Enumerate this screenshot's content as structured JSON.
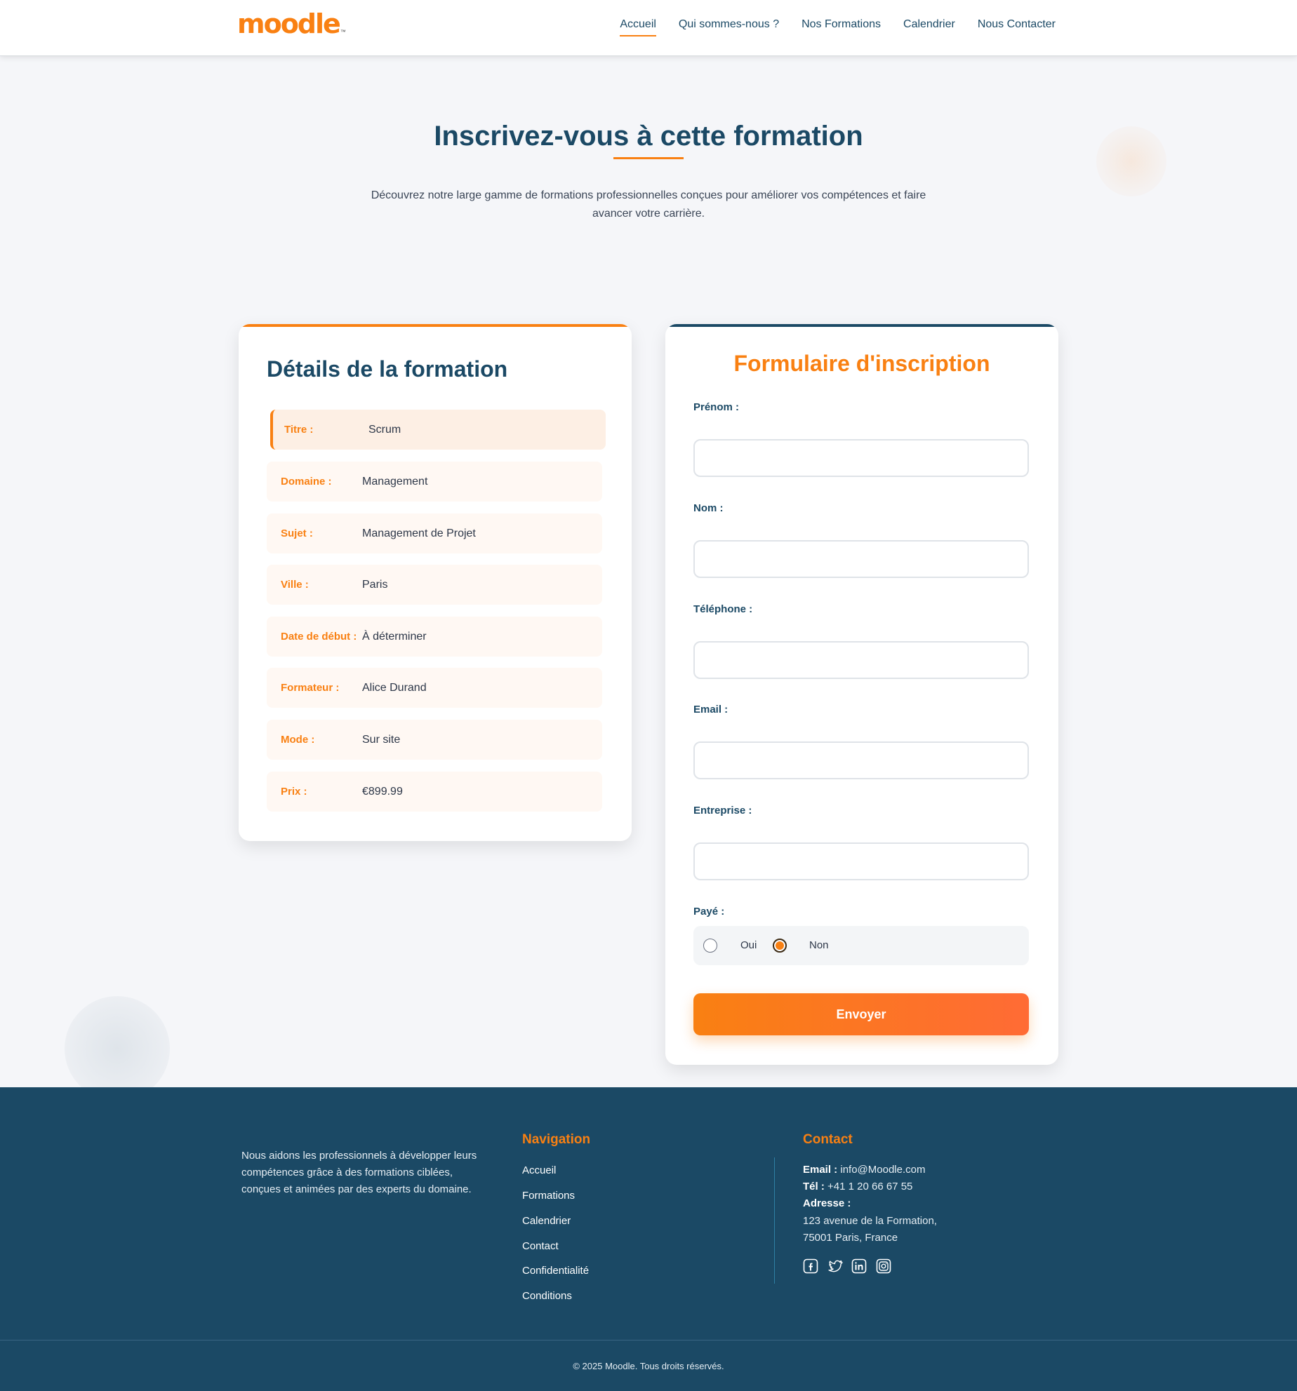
{
  "brand": {
    "name": "moodle",
    "tm": "™",
    "accent_color": "#f98012",
    "primary_color": "#1b4965"
  },
  "nav": {
    "items": [
      {
        "label": "Accueil",
        "active": true
      },
      {
        "label": "Qui sommes-nous ?",
        "active": false
      },
      {
        "label": "Nos Formations",
        "active": false
      },
      {
        "label": "Calendrier",
        "active": false
      },
      {
        "label": "Nous Contacter",
        "active": false
      }
    ]
  },
  "hero": {
    "title": "Inscrivez-vous à cette formation",
    "subtitle": "Découvrez notre large gamme de formations professionnelles conçues pour améliorer vos compétences et faire avancer votre carrière."
  },
  "details": {
    "title": "Détails de la formation",
    "rows": [
      {
        "label": "Titre :",
        "value": "Scrum"
      },
      {
        "label": "Domaine :",
        "value": "Management"
      },
      {
        "label": "Sujet :",
        "value": "Management de Projet"
      },
      {
        "label": "Ville :",
        "value": "Paris"
      },
      {
        "label": "Date de début :",
        "value": "À déterminer"
      },
      {
        "label": "Formateur :",
        "value": "Alice Durand"
      },
      {
        "label": "Mode :",
        "value": "Sur site"
      },
      {
        "label": "Prix :",
        "value": "€899.99"
      }
    ]
  },
  "form": {
    "title": "Formulaire d'inscription",
    "fields": [
      {
        "label": "Prénom :",
        "value": "",
        "placeholder": ""
      },
      {
        "label": "Nom :",
        "value": "",
        "placeholder": ""
      },
      {
        "label": "Téléphone :",
        "value": "",
        "placeholder": ""
      },
      {
        "label": "Email :",
        "value": "",
        "placeholder": ""
      },
      {
        "label": "Entreprise :",
        "value": "",
        "placeholder": ""
      }
    ],
    "paid": {
      "label": "Payé :",
      "options": [
        "Oui",
        "Non"
      ],
      "selected": "Non"
    },
    "submit_label": "Envoyer"
  },
  "footer": {
    "about": "Nous aidons les professionnels à développer leurs compétences grâce à des formations ciblées, conçues et animées par des experts du domaine.",
    "navigation": {
      "heading": "Navigation",
      "links": [
        "Accueil",
        "Formations",
        "Calendrier",
        "Contact",
        "Confidentialité",
        "Conditions"
      ]
    },
    "contact": {
      "heading": "Contact",
      "email_label": "Email :",
      "email": "info@Moodle.com",
      "phone_label": "Tél :",
      "phone": "+41 1 20 66 67 55",
      "address_label": "Adresse :",
      "address_line1": "123 avenue de la Formation,",
      "address_line2": "75001 Paris, France",
      "socials": [
        "facebook-icon",
        "twitter-icon",
        "linkedin-icon",
        "instagram-icon"
      ]
    },
    "copyright": "© 2025 Moodle. Tous droits réservés."
  }
}
